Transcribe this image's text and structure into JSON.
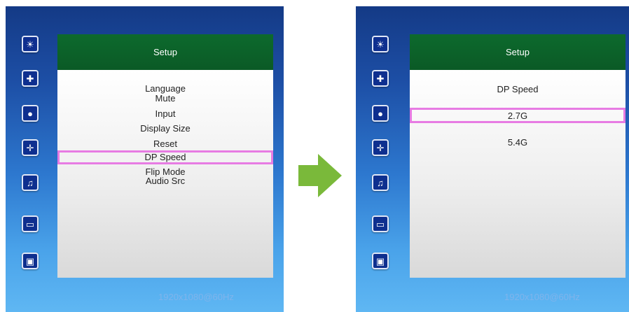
{
  "colors": {
    "accent_green": "#0b5a26",
    "highlight": "#e77be3",
    "arrow": "#7ab93a"
  },
  "left": {
    "title": "Setup",
    "menu": [
      "Language",
      "Mute",
      "Input",
      "Display Size",
      "Reset",
      "DP Speed",
      "Flip Mode",
      "Audio Src"
    ],
    "selected": "DP Speed",
    "resolution": "1920x1080@60Hz"
  },
  "right": {
    "title": "Setup",
    "heading": "DP Speed",
    "options": [
      "2.7G",
      "5.4G"
    ],
    "selected": "2.7G",
    "resolution": "1920x1080@60Hz"
  },
  "sidebar_icons": [
    "brightness-icon",
    "position-icon",
    "color-icon",
    "image-adjust-icon",
    "sound-icon",
    "setup-icon",
    "pip-icon"
  ],
  "transition": "arrow-right-icon"
}
